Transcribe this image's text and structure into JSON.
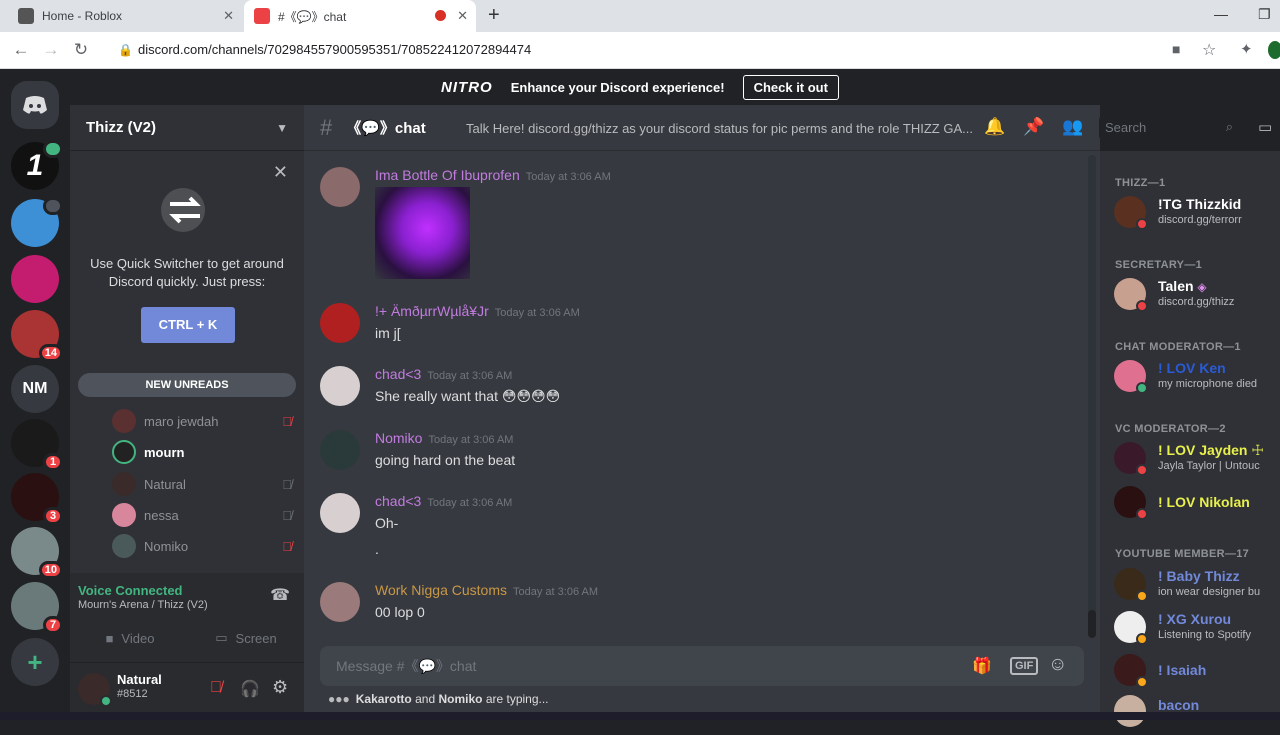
{
  "browser": {
    "tabs": [
      {
        "title": "Home - Roblox"
      },
      {
        "title": "#《💬》chat"
      }
    ],
    "url": "discord.com/channels/702984557900595351/708522412072894474"
  },
  "nitro_banner": {
    "logo": "NITRO",
    "text": "Enhance your Discord experience!",
    "button": "Check it out"
  },
  "guilds": [
    {
      "label": "",
      "badge": ""
    },
    {
      "label": "",
      "badge": ""
    },
    {
      "label": "",
      "badge": ""
    },
    {
      "label": "",
      "badge": ""
    },
    {
      "label": "",
      "badge": "14"
    },
    {
      "label": "NM",
      "badge": ""
    },
    {
      "label": "",
      "badge": "1"
    },
    {
      "label": "",
      "badge": "3"
    },
    {
      "label": "",
      "badge": "10"
    },
    {
      "label": "",
      "badge": "7"
    }
  ],
  "server": {
    "name": "Thizz (V2)"
  },
  "quick_switcher": {
    "text_line1": "Use Quick Switcher to get around",
    "text_line2": "Discord quickly. Just press:",
    "button": "CTRL + K"
  },
  "new_unreads": "NEW UNREADS",
  "voice_users": [
    {
      "name": "maro jewdah",
      "active": false
    },
    {
      "name": "mourn",
      "active": true
    },
    {
      "name": "Natural",
      "active": false
    },
    {
      "name": "nessa",
      "active": false
    },
    {
      "name": "Nomiko",
      "active": false
    }
  ],
  "voice": {
    "status": "Voice Connected",
    "location": "Mourn's Arena / Thizz (V2)",
    "video": "Video",
    "screen": "Screen"
  },
  "user": {
    "name": "Natural",
    "tag": "#8512"
  },
  "channel": {
    "name": "《💬》chat",
    "topic": "Talk Here! discord.gg/thizz as your discord status for pic perms and the role THIZZ GA...",
    "search_placeholder": "Search"
  },
  "messages": [
    {
      "author": "Ima Bottle Of Ibuprofen",
      "time": "Today at 3:06 AM",
      "text": "",
      "color": "#c27ce0"
    },
    {
      "author": "!+ ÄmðµrrWµlå¥Jr",
      "time": "Today at 3:06 AM",
      "text": "im j[",
      "color": "#c27ce0"
    },
    {
      "author": "chad<3",
      "time": "Today at 3:06 AM",
      "text": "She really want that 😳😳😳😳",
      "color": "#c27ce0"
    },
    {
      "author": "Nomiko",
      "time": "Today at 3:06 AM",
      "text": "going hard on the beat",
      "color": "#c27ce0"
    },
    {
      "author": "chad<3",
      "time": "Today at 3:06 AM",
      "text": "Oh-",
      "text2": ".",
      "color": "#c27ce0"
    },
    {
      "author": "Work Nigga Customs",
      "time": "Today at 3:06 AM",
      "text": "00 lop 0",
      "color": "#c99846"
    }
  ],
  "composer": {
    "placeholder": "Message #《💬》chat",
    "gif": "GIF"
  },
  "typing": {
    "user1": "Kakarotto",
    "and": " and ",
    "user2": "Nomiko",
    "suffix": " are typing..."
  },
  "members": {
    "roles": [
      "THIZZ—1",
      "SECRETARY—1",
      "CHAT MODERATOR—1",
      "VC MODERATOR—2",
      "YOUTUBE MEMBER—17"
    ],
    "list": [
      {
        "name": "!TG Thizzkid",
        "status": "discord.gg/terrorr",
        "color": "#ffffff"
      },
      {
        "name": "Talen",
        "status": "discord.gg/thizz",
        "color": "#ffffff"
      },
      {
        "name": "! LOV Ken",
        "status": "my microphone died",
        "color": "#2a5bd7"
      },
      {
        "name": "! LOV Jayden ☩",
        "status": "Jayla Taylor | Untouc",
        "color": "#e8f04b"
      },
      {
        "name": "! LOV Nikolan",
        "status": "",
        "color": "#e8f04b"
      },
      {
        "name": "! Baby Thizz",
        "status": "ion wear designer bu",
        "color": "#7289da"
      },
      {
        "name": "! XG Xurou",
        "status": "Listening to Spotify",
        "color": "#7289da"
      },
      {
        "name": "! Isaiah",
        "status": "",
        "color": "#7289da"
      },
      {
        "name": "bacon",
        "status": "",
        "color": "#7289da"
      }
    ]
  }
}
